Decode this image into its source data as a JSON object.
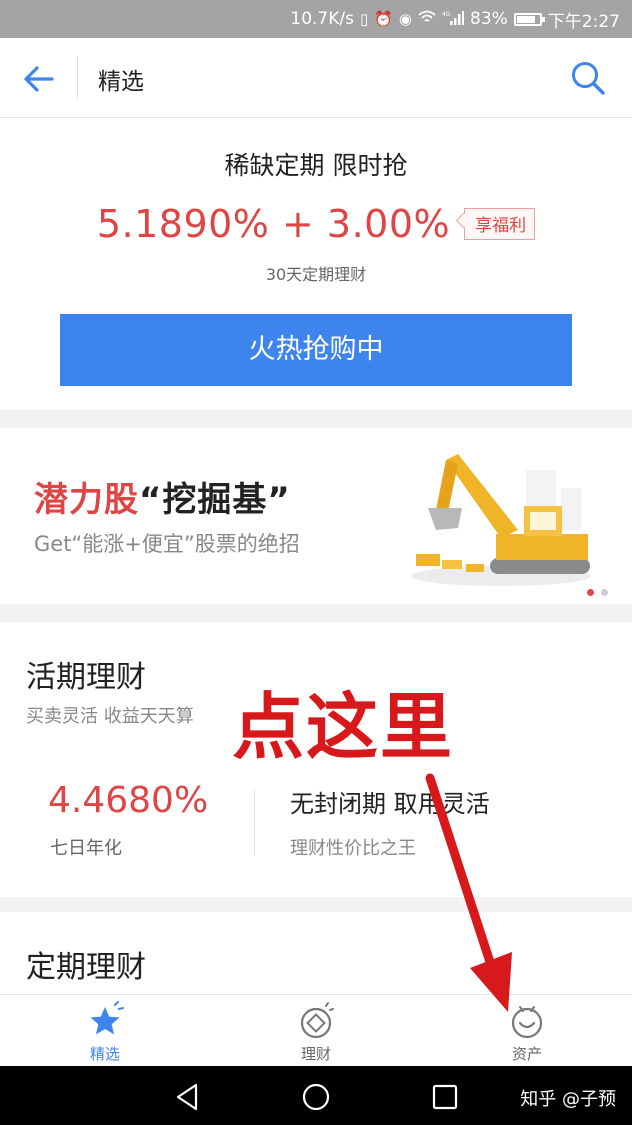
{
  "status_bar": {
    "speed": "10.7K/s",
    "signal_label": "4G",
    "battery": "83%",
    "battery_level": 0.83,
    "time": "下午2:27"
  },
  "header": {
    "title": "精选",
    "back_icon": "arrow-left-icon",
    "search_icon": "search-icon",
    "accent_color": "#3d84ee"
  },
  "promo": {
    "title": "稀缺定期 限时抢",
    "rate": "5.1890% + 3.00%",
    "tag": "享福利",
    "subtitle": "30天定期理财",
    "button": "火热抢购中"
  },
  "banner": {
    "title_red": "潜力股",
    "title_black": "“挖掘基”",
    "subtitle": "Get“能涨+便宜”股票的绝招",
    "image_icon": "excavator-icon"
  },
  "current": {
    "title": "活期理财",
    "subtitle": "买卖灵活 收益天天算",
    "rate": "4.4680%",
    "rate_label": "七日年化",
    "feature": "无封闭期 取用灵活",
    "feature_sub": "理财性价比之王"
  },
  "annotation": {
    "text": "点这里",
    "color": "#d8191c"
  },
  "fixed": {
    "title": "定期理财"
  },
  "tabbar": {
    "items": [
      {
        "label": "精选",
        "icon": "star-icon",
        "active": true
      },
      {
        "label": "理财",
        "icon": "finance-icon",
        "active": false
      },
      {
        "label": "资产",
        "icon": "assets-icon",
        "active": false
      }
    ]
  },
  "navbar": {
    "watermark": "知乎 @子预"
  }
}
